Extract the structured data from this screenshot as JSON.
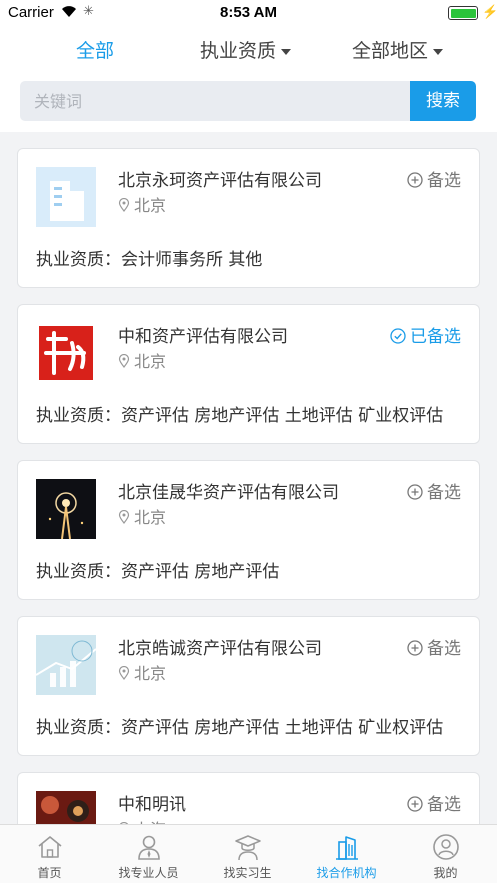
{
  "status_bar": {
    "carrier": "Carrier",
    "time": "8:53 AM"
  },
  "filters": [
    {
      "label": "全部",
      "active": true
    },
    {
      "label": "执业资质",
      "active": false
    },
    {
      "label": "全部地区",
      "active": false
    }
  ],
  "search": {
    "placeholder": "关键词",
    "button_label": "搜索"
  },
  "cards": [
    {
      "name": "北京永珂资产评估有限公司",
      "location": "北京",
      "favorite_label": "备选",
      "favorited": false,
      "qualifications": "执业资质：会计师事务所 其他",
      "logo_icon": "building-logo"
    },
    {
      "name": "中和资产评估有限公司",
      "location": "北京",
      "favorite_label": "已备选",
      "favorited": true,
      "qualifications": "执业资质：资产评估 房地产评估 土地评估 矿业权评估",
      "logo_icon": "zhonghe-calligraphy-logo"
    },
    {
      "name": "北京佳晟华资产评估有限公司",
      "location": "北京",
      "favorite_label": "备选",
      "favorited": false,
      "qualifications": "执业资质：资产评估 房地产评估",
      "logo_icon": "tower-night-photo"
    },
    {
      "name": "北京皓诚资产评估有限公司",
      "location": "北京",
      "favorite_label": "备选",
      "favorited": false,
      "qualifications": "执业资质：资产评估 房地产评估 土地评估 矿业权评估",
      "logo_icon": "chart-graphic-logo"
    },
    {
      "name": "中和明讯",
      "location": "上海",
      "favorite_label": "备选",
      "favorited": false,
      "qualifications": "",
      "logo_icon": "paisley-pattern-logo"
    }
  ],
  "tabs": [
    {
      "label": "首页",
      "icon": "home-icon",
      "active": false
    },
    {
      "label": "找专业人员",
      "icon": "person-icon",
      "active": false
    },
    {
      "label": "找实习生",
      "icon": "graduate-icon",
      "active": false
    },
    {
      "label": "找合作机构",
      "icon": "buildings-icon",
      "active": true
    },
    {
      "label": "我的",
      "icon": "profile-icon",
      "active": false
    }
  ],
  "colors": {
    "accent": "#1a9ce8",
    "background": "#f2f3f5"
  }
}
